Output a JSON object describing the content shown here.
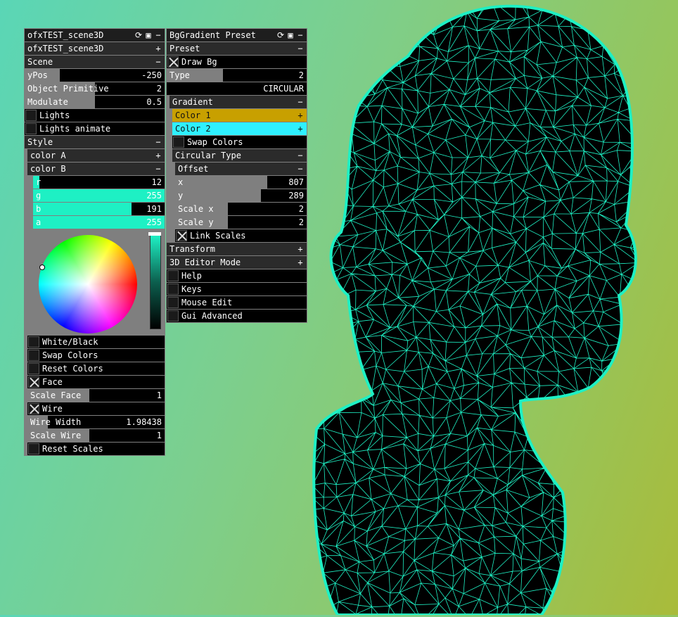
{
  "left_panel": {
    "title": "ofxTEST_scene3D",
    "subtitle": "ofxTEST_scene3D",
    "scene": {
      "header": "Scene",
      "ypos": {
        "label": "yPos",
        "value": "-250",
        "fraction": 0.25
      },
      "object_primitive": {
        "label": "Object Primitive",
        "value": "2",
        "fraction": 0.5
      },
      "modulate": {
        "label": "Modulate",
        "value": "0.5",
        "fraction": 0.5
      },
      "lights": "Lights",
      "lights_animate": "Lights animate"
    },
    "style": {
      "header": "Style",
      "color_a": "color A",
      "color_b": "color B",
      "r": {
        "label": "r",
        "value": "12",
        "fraction": 0.05
      },
      "g": {
        "label": "g",
        "value": "255",
        "fraction": 1.0
      },
      "b": {
        "label": "b",
        "value": "191",
        "fraction": 0.75
      },
      "a": {
        "label": "a",
        "value": "255",
        "fraction": 1.0
      },
      "white_black": "White/Black",
      "swap_colors": "Swap Colors",
      "reset_colors": "Reset Colors",
      "face": "Face",
      "scale_face": {
        "label": "Scale Face",
        "value": "1",
        "fraction": 0.45
      },
      "wire": "Wire",
      "wire_width": {
        "label": "Wire Width",
        "value": "1.98438",
        "fraction": 0.15
      },
      "scale_wire": {
        "label": "Scale Wire",
        "value": "1",
        "fraction": 0.45
      },
      "reset_scales": "Reset Scales"
    }
  },
  "right_panel": {
    "title": "BgGradient Preset",
    "preset": {
      "header": "Preset",
      "draw_bg": "Draw Bg",
      "type": {
        "label": "Type",
        "value": "2",
        "fraction": 0.4
      },
      "type_name": "CIRCULAR"
    },
    "gradient": {
      "header": "Gradient",
      "color1": "Color 1",
      "color2": "Color 2",
      "swap_colors": "Swap Colors"
    },
    "circular": {
      "header": "Circular Type",
      "offset": "Offset",
      "x": {
        "label": "x",
        "value": "807",
        "fraction": 0.7
      },
      "y": {
        "label": "y",
        "value": "289",
        "fraction": 0.65
      },
      "scale_x": {
        "label": "Scale x",
        "value": "2",
        "fraction": 0.4
      },
      "scale_y": {
        "label": "Scale y",
        "value": "2",
        "fraction": 0.4
      },
      "link_scales": "Link Scales"
    },
    "transform": "Transform",
    "editor_mode": "3D Editor Mode",
    "help": "Help",
    "keys": "Keys",
    "mouse_edit": "Mouse Edit",
    "gui_advanced": "Gui Advanced"
  },
  "symbols": {
    "minus": "−",
    "plus": "+",
    "refresh": "⟳",
    "save": "▣"
  },
  "colors": {
    "color1": "#c8a000",
    "color2": "#2ef0ff",
    "mesh": "#1ef0c4",
    "accent_slider": "#1ef0c4"
  }
}
